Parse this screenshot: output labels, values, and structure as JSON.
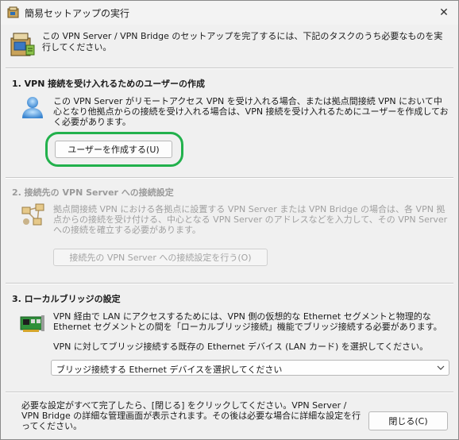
{
  "window": {
    "title": "簡易セットアップの実行",
    "close_symbol": "✕"
  },
  "intro": {
    "text": "この VPN Server / VPN Bridge のセットアップを完了するには、下記のタスクのうち必要なものを実行してください。"
  },
  "section1": {
    "title": "1. VPN 接続を受け入れるためのユーザーの作成",
    "description": "この VPN Server がリモートアクセス VPN を受け入れる場合、または拠点間接続 VPN において中心となり他拠点からの接続を受け入れる場合は、VPN 接続を受け入れるためにユーザーを作成しておく必要があります。",
    "button_label": "ユーザーを作成する(U)"
  },
  "section2": {
    "title": "2. 接続先の VPN Server への接続設定",
    "description": "拠点間接続 VPN における各拠点に設置する VPN Server または VPN Bridge の場合は、各 VPN 拠点からの接続を受け付ける、中心となる VPN Server のアドレスなどを入力して、その VPN Server への接続を確立する必要があります。",
    "button_label": "接続先の VPN Server への接続設定を行う(O)"
  },
  "section3": {
    "title": "3. ローカルブリッジの設定",
    "description": "VPN 経由で LAN にアクセスするためには、VPN 側の仮想的な Ethernet セグメントと物理的な Ethernet セグメントとの間を「ローカルブリッジ接続」機能でブリッジ接続する必要があります。",
    "select_prompt": "VPN に対してブリッジ接続する既存の Ethernet デバイス (LAN カード) を選択してください。",
    "select_value": "ブリッジ接続する Ethernet デバイスを選択してください"
  },
  "footer": {
    "text": "必要な設定がすべて完了したら、[閉じる] をクリックしてください。VPN Server / VPN Bridge の詳細な管理画面が表示されます。その後は必要な場合に詳細な設定を行ってください。",
    "close_button_label": "閉じる(C)"
  },
  "icons": {
    "title": "setup-window-icon",
    "intro": "server-setup-icon",
    "section1": "user-icon",
    "section2": "network-connection-icon",
    "section3": "network-card-icon"
  },
  "colors": {
    "highlight": "#22b14c",
    "disabled_text": "#a0a0a0"
  }
}
